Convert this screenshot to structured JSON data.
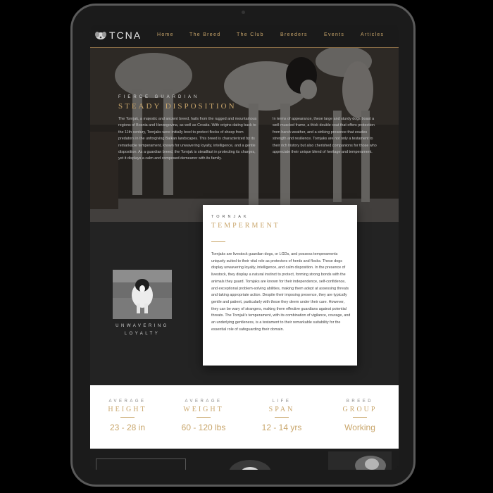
{
  "nav": {
    "logo_text": "TCNA",
    "items": [
      {
        "label": "Home"
      },
      {
        "label": "The Breed"
      },
      {
        "label": "The Club"
      },
      {
        "label": "Breeders"
      },
      {
        "label": "Events"
      },
      {
        "label": "Articles"
      }
    ]
  },
  "hero": {
    "eyebrow": "FIERCE GUARDIAN",
    "title": "STEADY DISPOSITION",
    "col_left": "The Tornjak, a majestic and ancient breed, hails from the rugged and mountainous regions of Bosnia and Herzegovina, as well as Croatia. With origins dating back to the 11th century, Tornjaks were initially bred to protect flocks of sheep from predators in the unforgiving Balkan landscapes. This breed is characterized by its remarkable temperament, known for unwavering loyalty, intelligence, and a gentle disposition. As a guardian breed, the Tornjak is steadfast in protecting its charges, yet it displays a calm and composed demeanor with its family.",
    "col_right": "In terms of appearance, these large and sturdy dogs boast a well-muscled frame, a thick double coat that offers protection from harsh weather, and a striking presence that exudes strength and resilience. Tornjaks are not only a testament to their rich history but also cherished companions for those who appreciate their unique blend of heritage and temperament."
  },
  "feature": {
    "caption_line1": "UNWAVERING",
    "caption_line2": "LOYALTY"
  },
  "card": {
    "eyebrow": "TORNJAK",
    "title": "TEMPERMENT",
    "body": "Tornjaks are livestock guardian dogs, or LGDs, and possess temperaments uniquely suited to their vital role as protectors of herds and flocks. These dogs display unwavering loyalty, intelligence, and calm disposition. In the presence of livestock, they display a natural instinct to protect, forming strong bonds with the animals they guard. Tornjaks are known for their independence, self-confidence, and exceptional problem-solving abilities, making them adept at assessing threats and taking appropriate action. Despite their imposing presence, they are typically gentle and patient, particularly with those they deem under their care. However, they can be wary of strangers, making them effective guardians against potential threats. The Tornjak's temperament, with its combination of vigilance, courage, and an underlying gentleness, is a testament to their remarkable suitability for the essential role of safeguarding their domain."
  },
  "stats": [
    {
      "label": "AVERAGE",
      "title": "HEIGHT",
      "value": "23 - 28 in"
    },
    {
      "label": "AVERAGE",
      "title": "WEIGHT",
      "value": "60 - 120 lbs"
    },
    {
      "label": "LIFE",
      "title": "SPAN",
      "value": "12 - 14 yrs"
    },
    {
      "label": "BREED",
      "title": "GROUP",
      "value": "Working"
    }
  ],
  "colors": {
    "accent_gold": "#c9a66b",
    "nav_bg": "#1a1a1a",
    "dark_section": "#232323"
  }
}
